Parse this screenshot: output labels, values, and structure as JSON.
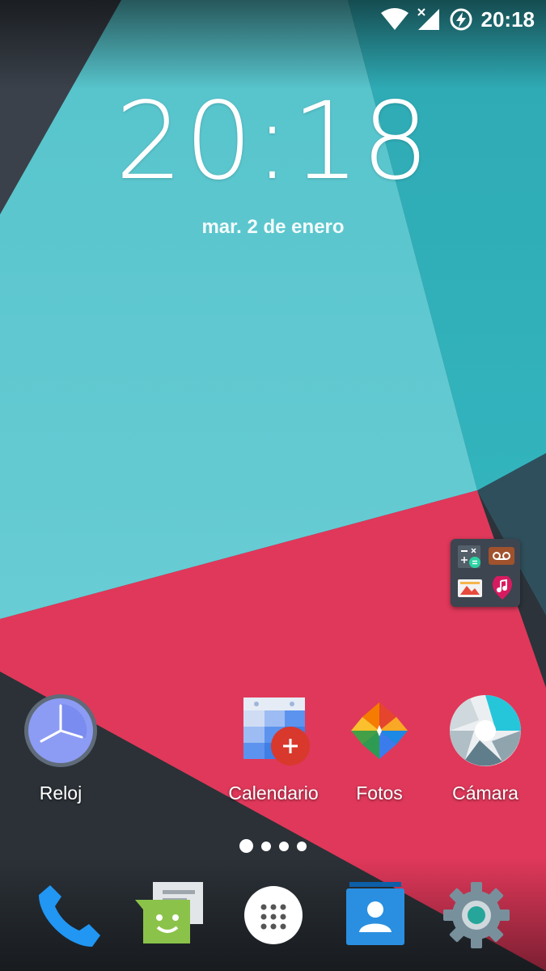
{
  "status_bar": {
    "time": "20:18",
    "icons": [
      "wifi-icon",
      "signal-no-service-icon",
      "battery-charging-icon"
    ]
  },
  "clock_widget": {
    "time": "20:18",
    "date": "mar. 2 de enero"
  },
  "folder": {
    "apps": [
      "calculator-icon",
      "voicemail-icon",
      "gallery-icon",
      "music-icon"
    ]
  },
  "home_apps": [
    {
      "label": "Reloj",
      "icon": "clock-icon"
    },
    {
      "label": "Calendario",
      "icon": "calendar-icon"
    },
    {
      "label": "Fotos",
      "icon": "photos-icon"
    },
    {
      "label": "Cámara",
      "icon": "camera-icon"
    }
  ],
  "page_indicator": {
    "pages": 4,
    "current": 1
  },
  "dock": [
    {
      "icon": "phone-icon"
    },
    {
      "icon": "messaging-icon"
    },
    {
      "icon": "app-drawer-icon"
    },
    {
      "icon": "contacts-icon"
    },
    {
      "icon": "settings-icon"
    }
  ],
  "colors": {
    "teal": "#5ccad2",
    "dark_teal": "#35b6c0",
    "red": "#e0385a",
    "charcoal": "#2b3137"
  }
}
